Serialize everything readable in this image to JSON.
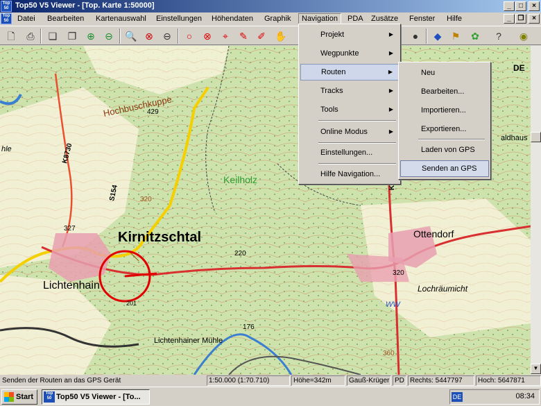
{
  "window": {
    "title": "Top50 V5 Viewer - [Top. Karte 1:50000]"
  },
  "menubar": {
    "items": [
      "Datei",
      "Bearbeiten",
      "Kartenauswahl",
      "Einstellungen",
      "Höhendaten",
      "Graphik",
      "Navigation",
      "PDA",
      "Zusätze",
      "Fenster",
      "Hilfe"
    ]
  },
  "navigation_menu": {
    "items": [
      "Projekt",
      "Wegpunkte",
      "Routen",
      "Tracks",
      "Tools",
      "Online Modus",
      "Einstellungen...",
      "Hilfe Navigation..."
    ]
  },
  "routen_submenu": {
    "items": [
      "Neu",
      "Bearbeiten...",
      "Importieren...",
      "Exportieren...",
      "Laden von GPS",
      "Senden an GPS"
    ]
  },
  "map": {
    "labels": {
      "kirnitzschtal": "Kirnitzschtal",
      "lichtenhain": "Lichtenhain",
      "ottendorf": "Ottendorf",
      "keilholz": "Keilholz",
      "hochbuschkuppe": "Hochbuschkuppe",
      "lochraumicht": "Lochräumicht",
      "lichtenhainer_muhle": "Lichtenhainer Mühle",
      "k8730": "K8730",
      "k8739": "K8739",
      "s154": "S154",
      "h429": "429",
      "h327": "327",
      "h320a": "320",
      "h320b": "320",
      "h220": "220",
      "h176": "176",
      "h360": "360",
      "ww": "WW",
      "edge_hle": "hle",
      "edge_de": "DE",
      "edge_aldhaus": "aldhaus",
      "h201": "201"
    }
  },
  "statusbar": {
    "message": "Senden der Routen an das GPS Gerät",
    "scale": "1:50.000  (1:70.710)",
    "height": "Höhe=342m",
    "projection": "Gauß-Krüger",
    "pd": "PD",
    "rechts": "Rechts: 5447797",
    "hoch": "Hoch: 5647871"
  },
  "taskbar": {
    "start": "Start",
    "task": "Top50 V5 Viewer - [To...",
    "lang": "DE",
    "clock": "08:34"
  },
  "colors": {
    "forest": "#cfe3b0",
    "town": "#e8a0b0",
    "road_yellow": "#f4d000",
    "road_red": "#d83030",
    "river": "#3a7fd0",
    "highlight": "#cfd8ea"
  }
}
